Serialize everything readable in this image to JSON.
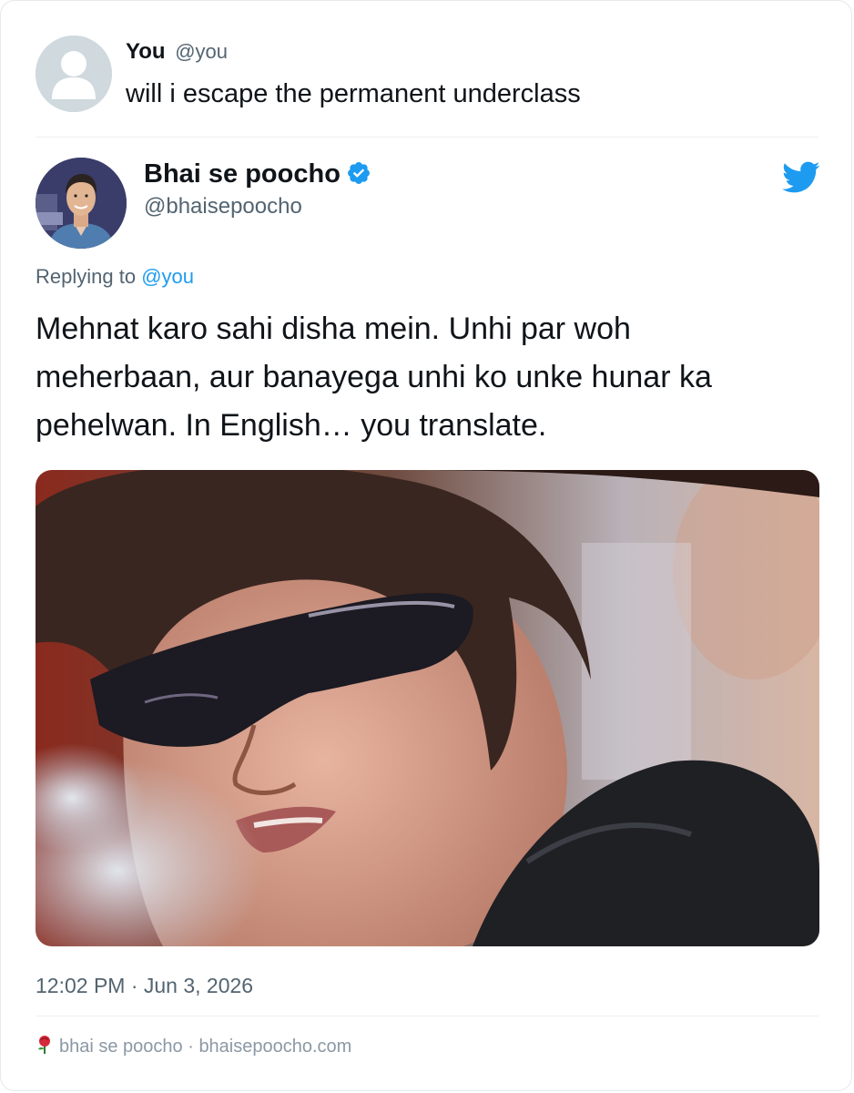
{
  "user_tweet": {
    "name": "You",
    "handle": "@you",
    "text": "will i escape the permanent underclass"
  },
  "reply_tweet": {
    "name": "Bhai se poocho",
    "handle": "@bhaisepoocho",
    "replying_prefix": "Replying to ",
    "replying_handle": "@you",
    "body_lines": [
      "Mehnat karo sahi disha mein. Unhi par woh",
      "meherbaan, aur banayega unhi ko unke hunar ka",
      "pehelwan. In English… you translate."
    ],
    "media_description_icon": "photo-man-with-sunglasses",
    "timestamp": "12:02 PM · Jun 3, 2026"
  },
  "footer": {
    "icon": "rose-icon",
    "text": "bhai se poocho · bhaisepoocho.com"
  },
  "colors": {
    "accent": "#1d9bf0",
    "text_primary": "#0f1419",
    "text_secondary": "#536471",
    "divider": "#eceef0"
  }
}
